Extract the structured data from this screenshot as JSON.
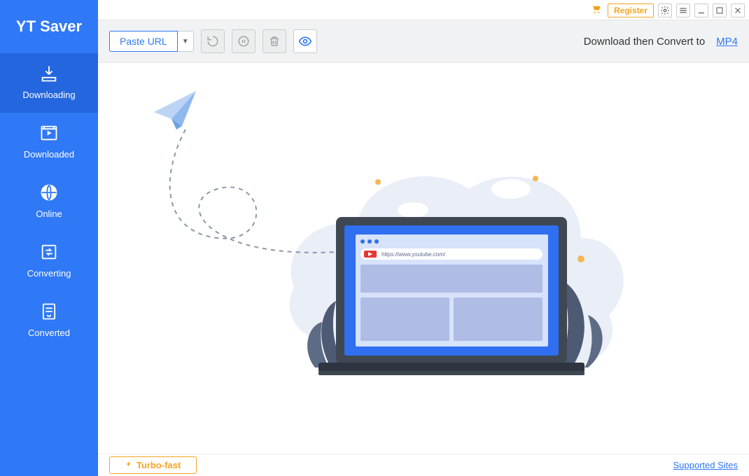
{
  "app": {
    "title": "YT Saver"
  },
  "sidebar": {
    "items": [
      {
        "label": "Downloading"
      },
      {
        "label": "Downloaded"
      },
      {
        "label": "Online"
      },
      {
        "label": "Converting"
      },
      {
        "label": "Converted"
      }
    ]
  },
  "winbar": {
    "register_label": "Register"
  },
  "toolbar": {
    "paste_label": "Paste URL",
    "convert_label": "Download then Convert to",
    "convert_format": "MP4"
  },
  "illustration": {
    "url_text": "https://www.youtube.com/"
  },
  "footer": {
    "turbo_label": "Turbo-fast",
    "supported_label": "Supported Sites"
  }
}
